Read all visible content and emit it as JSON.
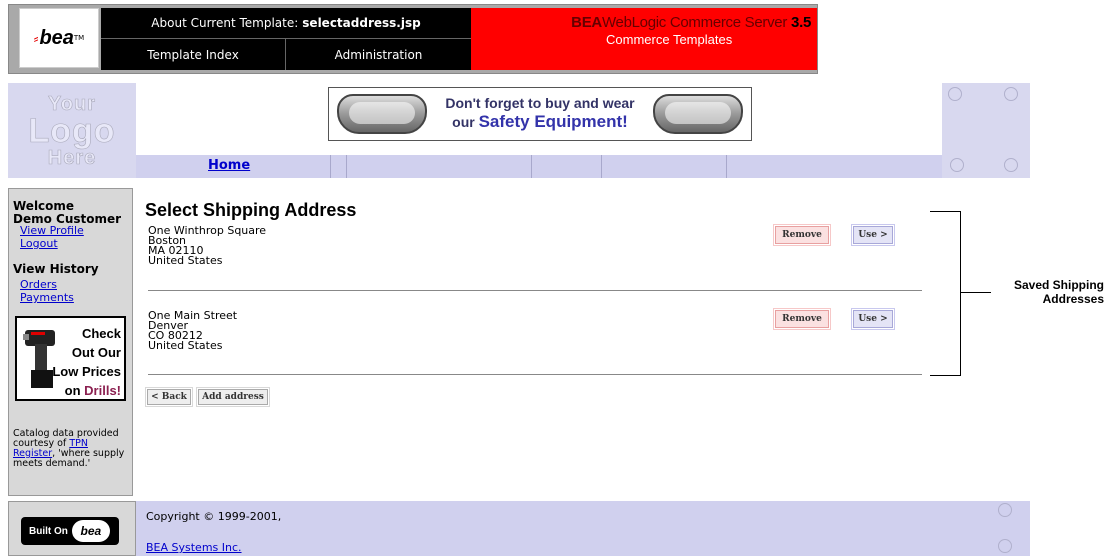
{
  "header": {
    "logo_text": "bea",
    "logo_tm": "TM",
    "about_label": "About Current Template:",
    "about_template": "selectaddress.jsp",
    "nav": {
      "template_index": "Template Index",
      "administration": "Administration"
    },
    "product_bea": "BEA",
    "product_name": "WebLogic Commerce Server",
    "product_version": "3.5",
    "product_subtitle": "Commerce Templates"
  },
  "branding": {
    "logo_placeholder": [
      "Your",
      "Logo",
      "Here"
    ]
  },
  "banner_ad": {
    "line1": "Don't forget to buy and wear",
    "line2_prefix": "our",
    "line2_bold": "Safety Equipment!"
  },
  "nav": {
    "home": "Home"
  },
  "sidebar": {
    "welcome": "Welcome",
    "customer_name": "Demo Customer",
    "view_profile": "View Profile",
    "logout": "Logout",
    "view_history": "View History",
    "orders": "Orders",
    "payments": "Payments",
    "drill_ad": [
      "Check",
      "Out Our",
      "Low Prices"
    ],
    "drill_ad_last_prefix": "on",
    "drill_ad_last_bold": "Drills!",
    "catalog_note_prefix": "Catalog data provided courtesy of",
    "catalog_note_link": "TPN Register",
    "catalog_note_suffix": ", 'where supply meets demand.'"
  },
  "main": {
    "title": "Select Shipping Address",
    "addresses": [
      {
        "street": "One Winthrop Square",
        "city": "Boston",
        "state_zip": "MA 02110",
        "country": "United States"
      },
      {
        "street": "One Main Street",
        "city": "Denver",
        "state_zip": "CO 80212",
        "country": "United States"
      }
    ],
    "remove_label": "Remove",
    "use_label": "Use >",
    "back_label": "< Back",
    "add_address_label": "Add address"
  },
  "callout": {
    "line1": "Saved Shipping",
    "line2": "Addresses"
  },
  "footer": {
    "built_on": "Built On",
    "built_on_logo": "bea",
    "copyright": "Copyright © 1999-2001,",
    "company_link": "BEA Systems Inc."
  },
  "colors": {
    "header_red": "#ff0000",
    "header_black": "#000000",
    "band_lavender": "#d0d0ee",
    "sidebar_grey": "#d8d8d8",
    "link_blue": "#0000cc",
    "remove_pink": "#fbe1e1",
    "use_lavender": "#e4e4f6"
  }
}
